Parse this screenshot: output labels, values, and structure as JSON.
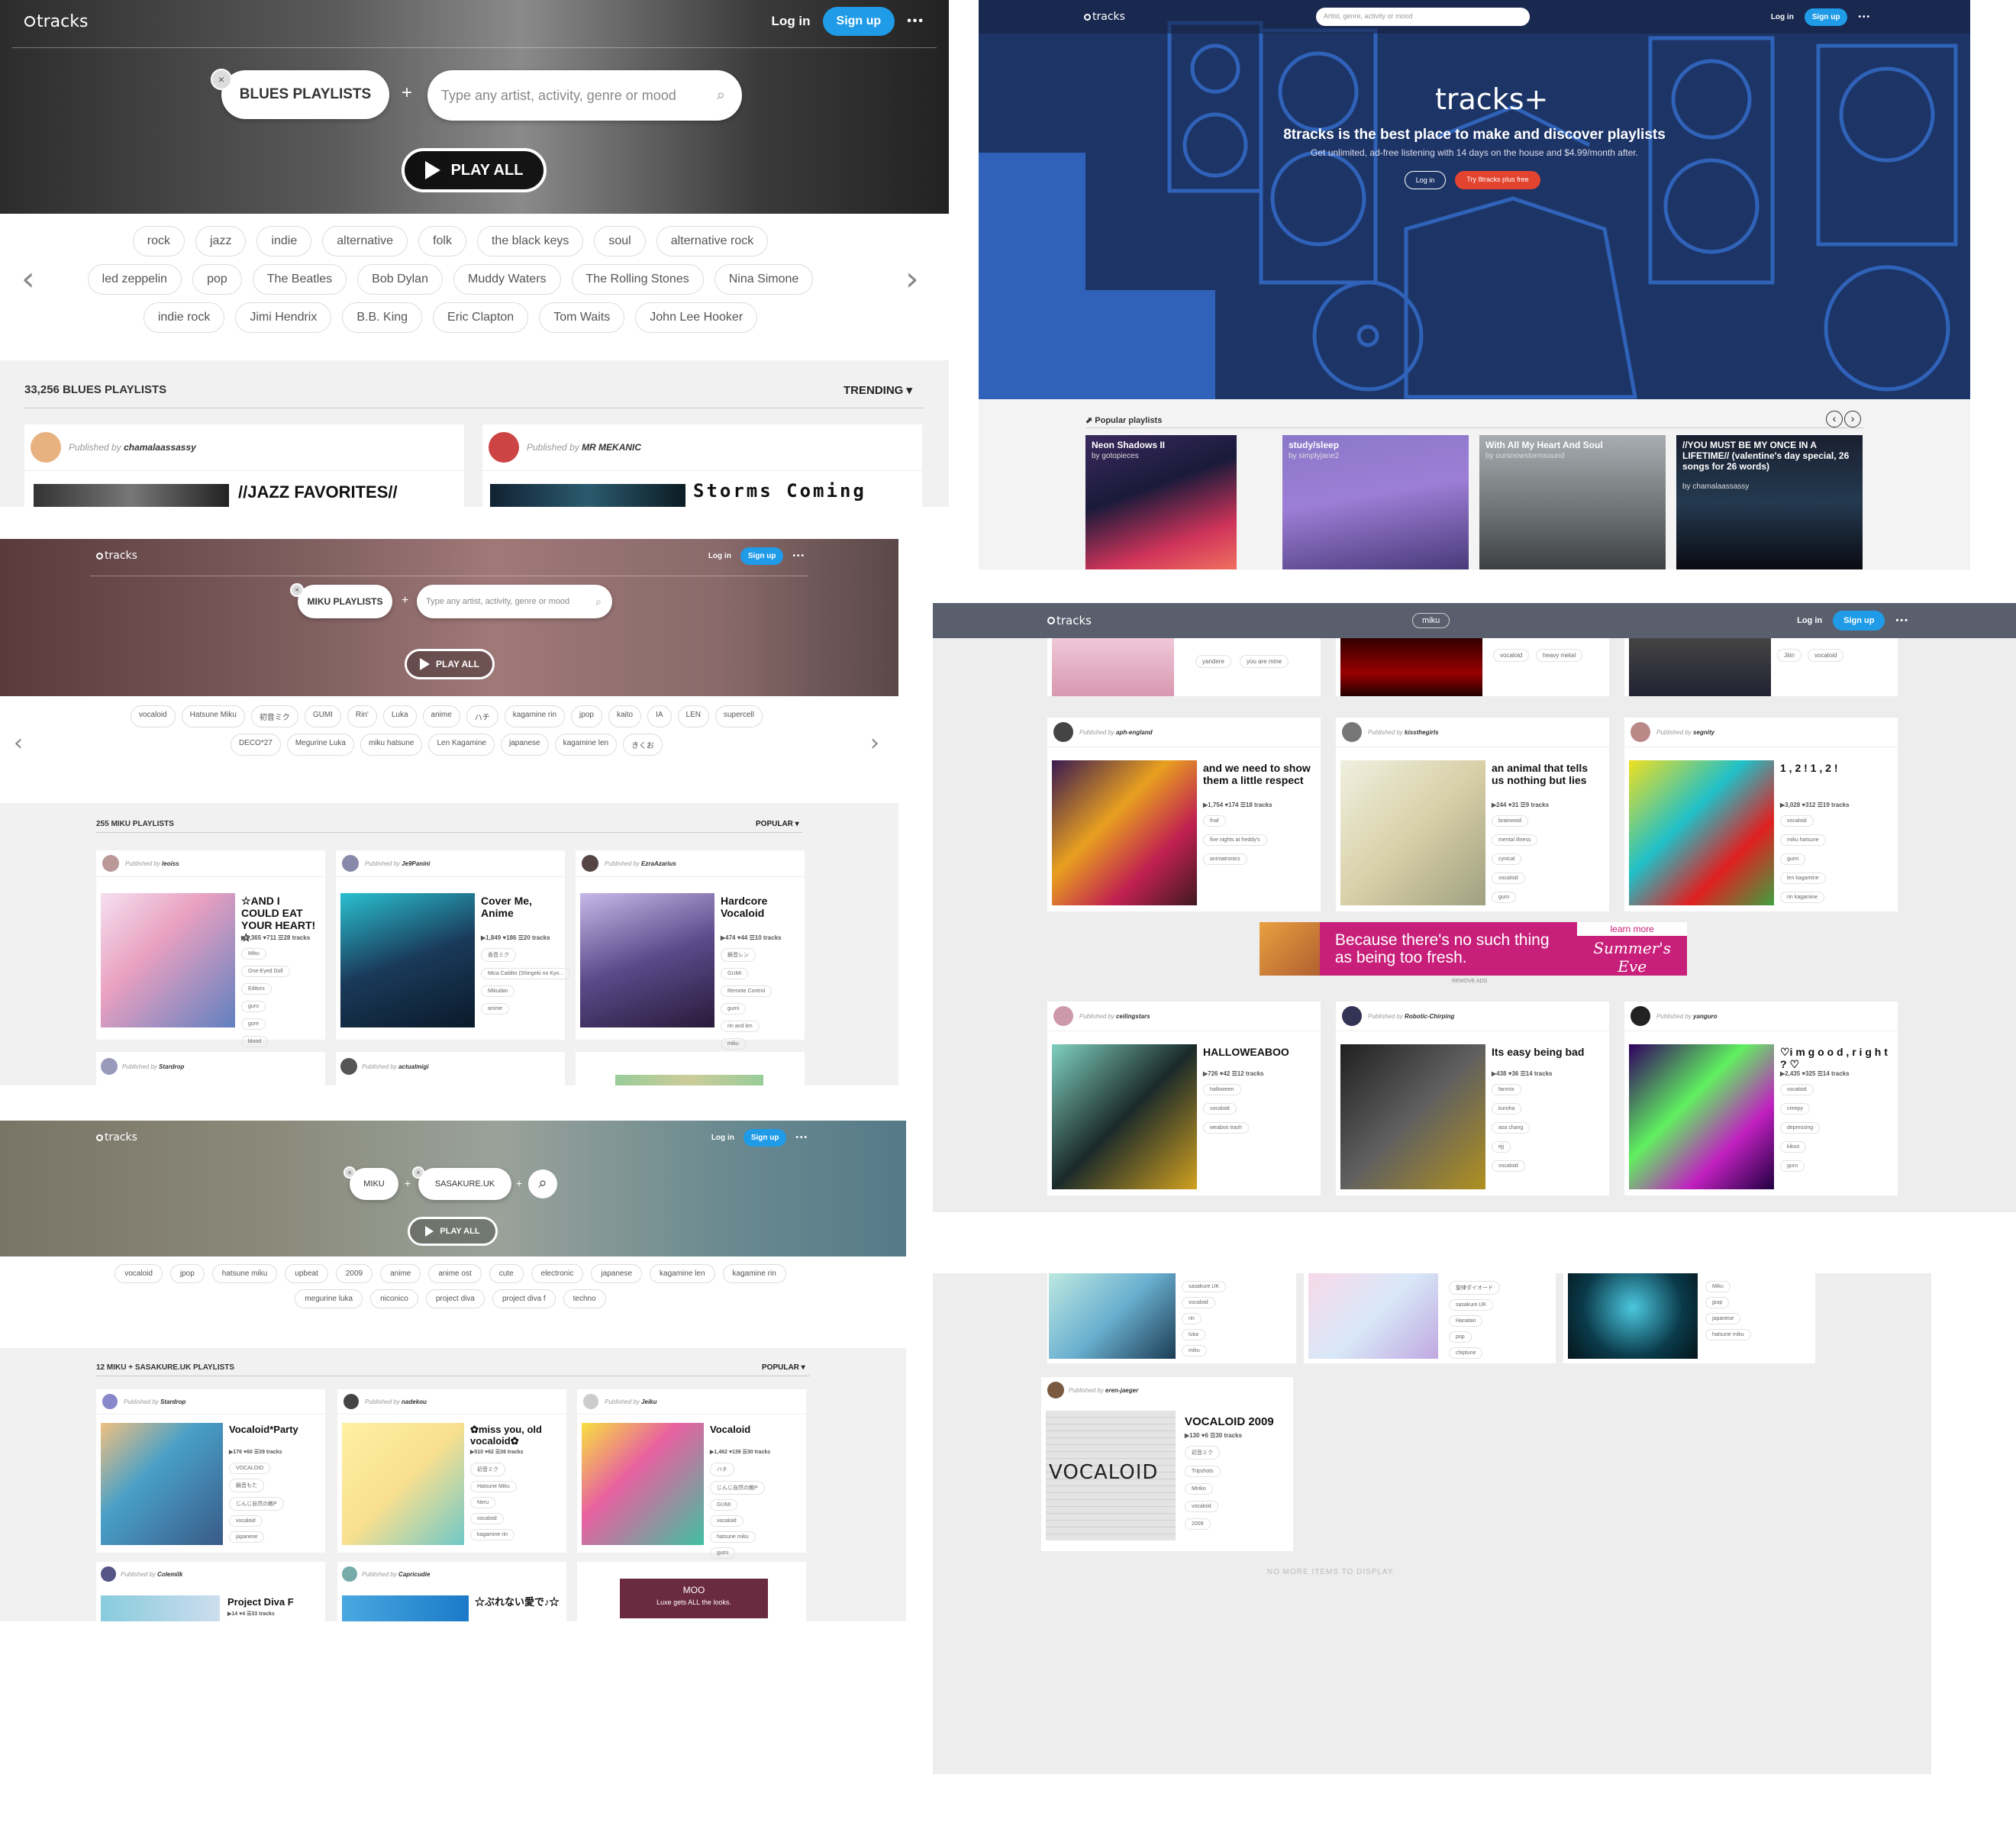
{
  "logo_text": "tracks",
  "login_label": "Log in",
  "signup_label": "Sign up",
  "more_label": "•••",
  "published_by": "Published by",
  "shot1": {
    "filter": "BLUES PLAYLISTS",
    "search_placeholder": "Type any artist, activity, genre or mood",
    "play_all": "PLAY ALL",
    "tags": [
      "rock",
      "jazz",
      "indie",
      "alternative",
      "folk",
      "the black keys",
      "soul",
      "alternative rock",
      "led zeppelin",
      "pop",
      "The Beatles",
      "Bob Dylan",
      "Muddy Waters",
      "The Rolling Stones",
      "Nina Simone",
      "indie rock",
      "Jimi Hendrix",
      "B.B. King",
      "Eric Clapton",
      "Tom Waits",
      "John Lee Hooker"
    ],
    "count": "33,256 BLUES PLAYLISTS",
    "sort": "TRENDING ▾",
    "cards": [
      {
        "user": "chamalaassassy",
        "title": "//JAZZ FAVORITES//"
      },
      {
        "user": "MR MEKANIC",
        "title": "Storms Coming"
      }
    ]
  },
  "shot2": {
    "search_placeholder": "Artist, genre, activity or mood",
    "brand": "tracks+",
    "headline": "8tracks is the best place to make and discover playlists",
    "subline": "Get unlimited, ad-free listening with 14 days on the house and $4.99/month after.",
    "login_btn": "Log in",
    "try_btn": "Try 8tracks plus free",
    "popular_label": "Popular playlists",
    "playlists": [
      {
        "title": "Neon Shadows II",
        "by": "by gotopieces"
      },
      {
        "title": "study/sleep",
        "by": "by simplyjane2"
      },
      {
        "title": "With All My Heart And Soul",
        "by": "by oursnowstormsound"
      },
      {
        "title": "//YOU MUST BE MY ONCE IN A LIFETIME// (valentine's day special, 26 songs for 26 words)",
        "by": "by chamalaassassy"
      }
    ]
  },
  "shot3": {
    "filter": "MIKU PLAYLISTS",
    "search_placeholder": "Type any artist, activity, genre or mood",
    "play_all": "PLAY ALL",
    "tags": [
      "vocaloid",
      "Hatsune Miku",
      "初音ミク",
      "GUMI",
      "Rin'",
      "Luka",
      "anime",
      "ハチ",
      "kagamine rin",
      "jpop",
      "kaito",
      "IA",
      "LEN",
      "supercell",
      "DECO*27",
      "Megurine Luka",
      "miku hatsune",
      "Len Kagamine",
      "japanese",
      "kagamine len",
      "きくお"
    ],
    "count": "255 MIKU PLAYLISTS",
    "sort": "POPULAR ▾",
    "cards": [
      {
        "user": "leoiss",
        "title": "☆AND I COULD EAT YOUR HEART!☆",
        "stats": "▶5,365 ♥711 ☰28 tracks",
        "tags": [
          "Miku",
          "One-Eyed Doll",
          "Editors",
          "guro",
          "gore",
          "blood"
        ]
      },
      {
        "user": "Je9Panini",
        "title": "Cover Me, Anime",
        "stats": "▶1,849 ♥186 ☰20 tracks",
        "tags": [
          "香音ミク",
          "Mica Caldito (Shingeki no Kyo...",
          "Mikudan",
          "anime"
        ]
      },
      {
        "user": "EzraAzarius",
        "title": "Hardcore Vocaloid",
        "stats": "▶474 ♥44 ☰10 tracks",
        "tags": [
          "鏡音レン",
          "GUMI",
          "Remote Control",
          "gumi",
          "rin and len",
          "miku"
        ]
      }
    ],
    "row2_users": [
      "Stardrop",
      "actualmigi"
    ]
  },
  "shot4": {
    "filter_a": "MIKU",
    "filter_b": "SASAKURE.UK",
    "play_all": "PLAY ALL",
    "tags": [
      "vocaloid",
      "jpop",
      "hatsune miku",
      "upbeat",
      "2009",
      "anime",
      "anime ost",
      "cute",
      "electronic",
      "japanese",
      "kagamine len",
      "kagamine rin",
      "megurine luka",
      "niconico",
      "project diva",
      "project diva f",
      "techno"
    ],
    "count": "12 MIKU + SASAKURE.UK PLAYLISTS",
    "sort": "POPULAR ▾",
    "cards": [
      {
        "user": "Stardrop",
        "title": "Vocaloid*Party",
        "stats": "▶176 ♥60 ☰39 tracks",
        "tags": [
          "VOCALOID",
          "鏡音もた",
          "じんじ自然の敵P",
          "vocaloid",
          "japanese"
        ]
      },
      {
        "user": "nadekou",
        "title": "✿miss you, old vocaloid✿",
        "stats": "▶510 ♥62 ☰36 tracks",
        "tags": [
          "初音ミク",
          "Hatsune Miku",
          "Neru",
          "vocaloid",
          "kagamine rin"
        ]
      },
      {
        "user": "Jeiku",
        "title": "Vocaloid",
        "stats": "▶1,462 ♥139 ☰30 tracks",
        "tags": [
          "ハチ",
          "じんじ自然の敵P",
          "GUMI",
          "vocaloid",
          "hatsune miku",
          "gumi"
        ]
      }
    ],
    "row2": [
      {
        "user": "Colemilk",
        "title": "Project Diva F",
        "stats": "▶14 ♥4 ☰33 tracks"
      },
      {
        "user": "Capricudie",
        "title": "☆ぶれない愛で♪☆"
      }
    ],
    "ad_brand": "MOO",
    "ad_text": "Luxe gets ALL the looks."
  },
  "shot5": {
    "search_value": "miku",
    "top_tags": [
      "yandere",
      "you are mine",
      "vocaloid",
      "heavy metal",
      "Jiiin",
      "vocaloid"
    ],
    "cards": [
      {
        "user": "aph-england",
        "title": "and we need to show them a little respect",
        "stats": "▶1,754 ♥174 ☰18 tracks",
        "tags": [
          "fnaf",
          "five nights at freddy's",
          "animatronics"
        ]
      },
      {
        "user": "kissthegirls",
        "title": "an animal that tells us nothing but lies",
        "stats": "▶244 ♥31 ☰9 tracks",
        "tags": [
          "brainwoid",
          "mental illness",
          "cynical",
          "vocaloid",
          "guro"
        ]
      },
      {
        "user": "segnity",
        "title": "1 , 2 ! 1 , 2 !",
        "stats": "▶3,028 ♥312 ☰19 tracks",
        "tags": [
          "vocaloid",
          "miku hatsune",
          "gumi",
          "len kagamine",
          "rin kagamine"
        ]
      }
    ],
    "ad_text": "Because there's no such thing as being too fresh.",
    "ad_learn": "learn more",
    "ad_brand": "Summer's Eve",
    "remove_ads": "REMOVE ADS",
    "cards2": [
      {
        "user": "ceilingstars",
        "title": "HALLOWEABOO",
        "stats": "▶726 ♥42 ☰12 tracks",
        "tags": [
          "halloween",
          "vocaloid",
          "weaboo trash"
        ]
      },
      {
        "user": "Robotic-Chirping",
        "title": "Its easy being bad",
        "stats": "▶438 ♥36 ☰14 tracks",
        "tags": [
          "fanmix",
          "kuroha",
          "asa chang",
          "ejj",
          "vocaloid"
        ]
      },
      {
        "user": "yanguro",
        "title": "♡i m g o o d , r i g h t ? ♡",
        "stats": "▶2,435 ♥325 ☰14 tracks",
        "tags": [
          "vocaloid",
          "creepy",
          "depressing",
          "kikuo",
          "guro"
        ]
      }
    ]
  },
  "shot6": {
    "tags_a": [
      "sasakure.UK",
      "vocaloid",
      "rin",
      "luka",
      "miku"
    ],
    "tags_b": [
      "旋律ダイオード",
      "sasakure.UK",
      "Hanatan",
      "pop",
      "chiptune"
    ],
    "tags_c": [
      "Miku",
      "jpop",
      "japanese",
      "hatsune miku"
    ],
    "card": {
      "user": "eren-jaeger",
      "title": "VOCALOID 2009",
      "stats": "▶130 ♥6 ☰30 tracks",
      "tags": [
        "初音ミク",
        "Tripshots",
        "Miriko",
        "vocaloid",
        "2009"
      ],
      "art_text": "VOCALOID"
    },
    "no_more": "NO MORE ITEMS TO DISPLAY."
  }
}
